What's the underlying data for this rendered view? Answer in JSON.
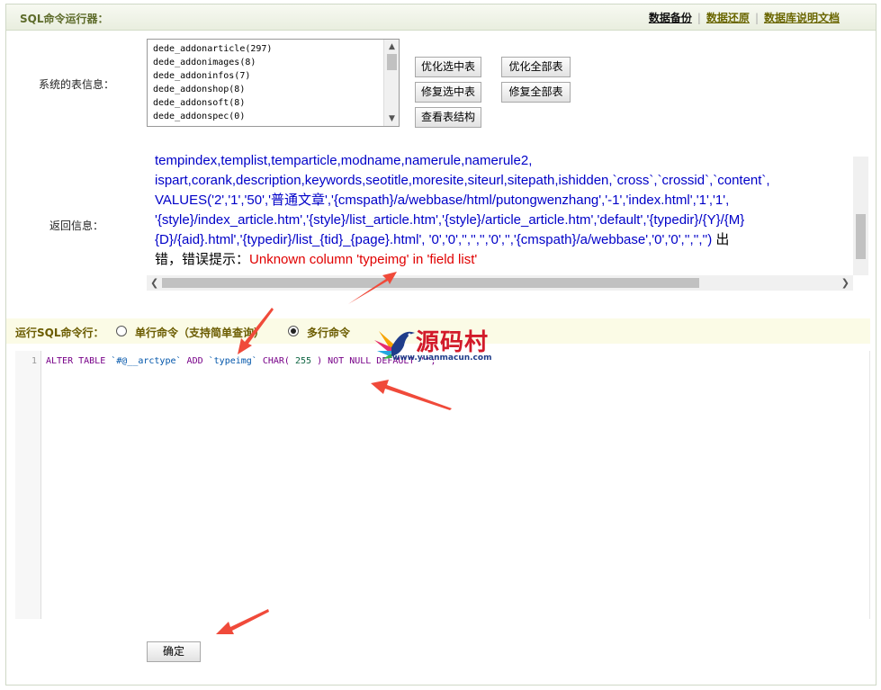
{
  "header": {
    "title": "SQL命令运行器：",
    "links": [
      "数据备份",
      "数据还原",
      "数据库说明文档"
    ]
  },
  "tables": {
    "label": "系统的表信息：",
    "items": [
      "dede_addonarticle(297)",
      "dede_addonimages(8)",
      "dede_addoninfos(7)",
      "dede_addonshop(8)",
      "dede_addonsoft(8)",
      "dede_addonspec(0)"
    ]
  },
  "buttons": {
    "optimize_selected": "优化选中表",
    "optimize_all": "优化全部表",
    "repair_selected": "修复选中表",
    "repair_all": "修复全部表",
    "view_structure": "查看表结构",
    "submit": "确定"
  },
  "result": {
    "label": "返回信息：",
    "lines": [
      "tempindex,templist,temparticle,modname,namerule,namerule2,",
      "ispart,corank,description,keywords,seotitle,moresite,siteurl,sitepath,ishidden,`cross`,`crossid`,`content`,",
      "VALUES('2','1','50','普通文章','{cmspath}/a/webbase/html/putongwenzhang','-1','index.html','1','1',",
      "'{style}/index_article.htm','{style}/list_article.htm','{style}/article_article.htm','default','{typedir}/{Y}/{M}",
      "{D}/{aid}.html','{typedir}/list_{tid}_{page}.html', '0','0','','','','0','','{cmspath}/a/webbase','0','0','','','')"
    ],
    "tail": " 出",
    "error_prefix": "错，错误提示：",
    "error_message": "Unknown column 'typeimg' in 'field list'"
  },
  "command": {
    "label": "运行SQL命令行：",
    "option_single": "单行命令（支持简单查询）",
    "option_multi": "多行命令",
    "selected": "multi"
  },
  "editor": {
    "line_number": "1",
    "code_keyword1": "ALTER TABLE ",
    "code_table": "`#@__arctype`",
    "code_keyword2": " ADD ",
    "code_column": "`typeimg`",
    "code_keyword3": " CHAR( ",
    "code_number": "255",
    "code_keyword4": " ) NOT NULL DEFAULT '';"
  },
  "watermark": {
    "name": "源码村",
    "url": "www.yuanmacun.com"
  },
  "colors": {
    "arrow": "#f04a3a",
    "error": "#e00000",
    "link": "#6a6600"
  }
}
